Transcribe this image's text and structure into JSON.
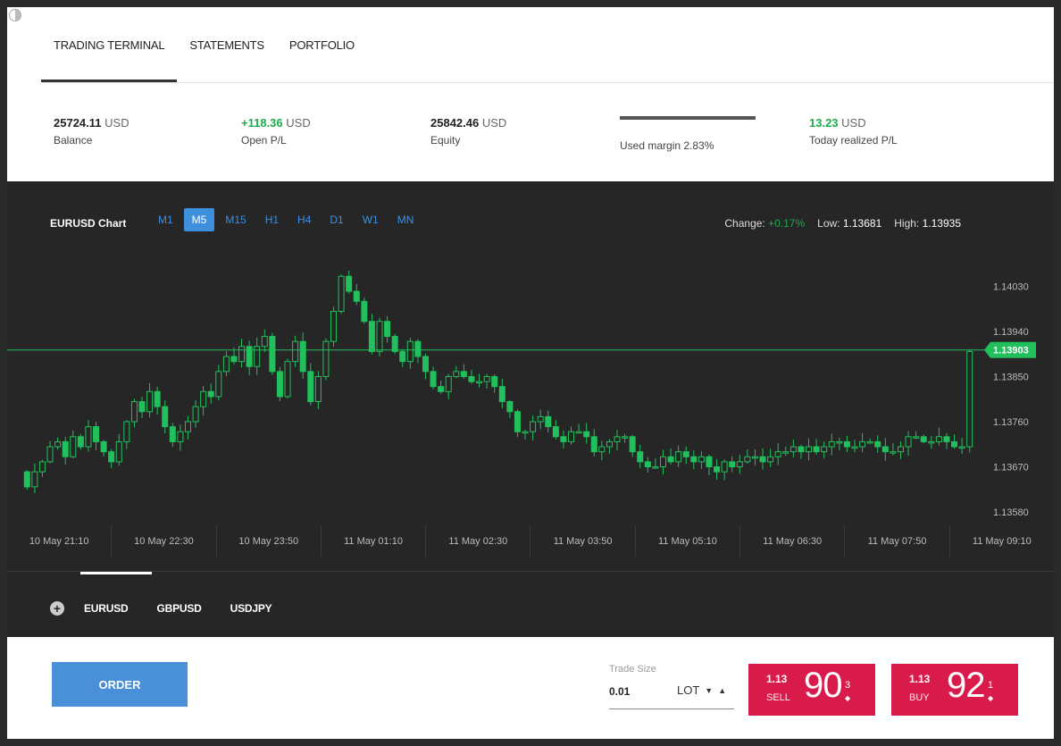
{
  "tabs": [
    {
      "label": "TRADING TERMINAL",
      "active": true
    },
    {
      "label": "STATEMENTS",
      "active": false
    },
    {
      "label": "PORTFOLIO",
      "active": false
    }
  ],
  "stats": {
    "balance": {
      "value": "25724.11",
      "unit": "USD",
      "label": "Balance"
    },
    "open_pl": {
      "value": "+118.36",
      "unit": "USD",
      "label": "Open P/L"
    },
    "equity": {
      "value": "25842.46",
      "unit": "USD",
      "label": "Equity"
    },
    "used_margin": {
      "label": "Used margin 2.83%"
    },
    "today_pl": {
      "value": "13.23",
      "unit": "USD",
      "label": "Today realized P/L"
    }
  },
  "chart_header": {
    "title": "EURUSD Chart",
    "timeframes": [
      "M1",
      "M5",
      "M15",
      "H1",
      "H4",
      "D1",
      "W1",
      "MN"
    ],
    "active_timeframe": "M5",
    "change_label": "Change:",
    "change_value": "+0.17%",
    "low_label": "Low:",
    "low_value": "1.13681",
    "high_label": "High:",
    "high_value": "1.13935"
  },
  "chart_data": {
    "type": "candlestick",
    "x_ticks": [
      "10 May 21:10",
      "10 May 22:30",
      "10 May 23:50",
      "11 May 01:10",
      "11 May 02:30",
      "11 May 03:50",
      "11 May 05:10",
      "11 May 06:30",
      "11 May 07:50",
      "11 May 09:10"
    ],
    "y_ticks": [
      "1.14030",
      "1.13940",
      "1.13850",
      "1.13760",
      "1.13670",
      "1.13580"
    ],
    "ylim": [
      1.1358,
      1.1407
    ],
    "current_price": "1.13903",
    "close_series": [
      1.1363,
      1.1366,
      1.1368,
      1.1371,
      1.1372,
      1.1369,
      1.1373,
      1.1371,
      1.1375,
      1.1372,
      1.137,
      1.1368,
      1.1372,
      1.1376,
      1.138,
      1.1378,
      1.1382,
      1.1379,
      1.1375,
      1.1372,
      1.1374,
      1.1376,
      1.1379,
      1.1382,
      1.1381,
      1.1386,
      1.1389,
      1.1388,
      1.1391,
      1.1387,
      1.1391,
      1.1393,
      1.1386,
      1.1381,
      1.1388,
      1.1392,
      1.1386,
      1.138,
      1.1385,
      1.1392,
      1.1398,
      1.1405,
      1.1402,
      1.14,
      1.1396,
      1.139,
      1.1396,
      1.1393,
      1.139,
      1.1388,
      1.1392,
      1.1389,
      1.1386,
      1.1383,
      1.1382,
      1.1385,
      1.1386,
      1.1385,
      1.1384,
      1.1384,
      1.1385,
      1.1383,
      1.138,
      1.1378,
      1.1374,
      1.1374,
      1.1376,
      1.1377,
      1.1375,
      1.1373,
      1.1372,
      1.1374,
      1.1374,
      1.1373,
      1.137,
      1.1371,
      1.1372,
      1.1373,
      1.1373,
      1.137,
      1.1368,
      1.1367,
      1.1367,
      1.1369,
      1.1368,
      1.137,
      1.1369,
      1.1368,
      1.1369,
      1.1367,
      1.1366,
      1.1368,
      1.1367,
      1.1368,
      1.1369,
      1.1369,
      1.1368,
      1.1369,
      1.137,
      1.137,
      1.1371,
      1.137,
      1.1371,
      1.137,
      1.1371,
      1.1372,
      1.1372,
      1.1371,
      1.1371,
      1.1372,
      1.1372,
      1.1371,
      1.137,
      1.137,
      1.1371,
      1.1373,
      1.1373,
      1.1372,
      1.1372,
      1.1373,
      1.1372,
      1.1371,
      1.1371,
      1.139
    ]
  },
  "symbols": [
    "EURUSD",
    "GBPUSD",
    "USDJPY"
  ],
  "order": {
    "button_label": "ORDER",
    "trade_size_label": "Trade Size",
    "trade_size_value": "0.01",
    "lot_label": "LOT",
    "sell": {
      "prefix": "1.13",
      "side": "SELL",
      "big": "90",
      "sup": "3"
    },
    "buy": {
      "prefix": "1.13",
      "side": "BUY",
      "big": "92",
      "sup": "1"
    },
    "accent_color": "#d91b4c",
    "order_color": "#4a90d9"
  }
}
